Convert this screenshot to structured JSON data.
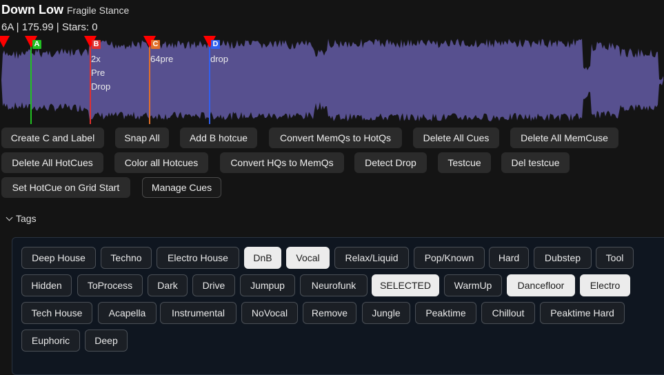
{
  "track": {
    "title": "Down Low",
    "artist": "Fragile Stance",
    "meta": "6A | 175.99 | Stars: 0"
  },
  "colors": {
    "waveform": "#57508f",
    "cue_a": "#22c022",
    "cue_b": "#e03030",
    "cue_c": "#e2702a",
    "cue_d": "#3060f0",
    "marker": "#ff0000"
  },
  "cues": [
    {
      "letter": "",
      "label": "",
      "color": "#ff0000"
    },
    {
      "letter": "A",
      "label": "",
      "color": "#22c022"
    },
    {
      "letter": "B",
      "label": "2x\nPre\nDrop",
      "color": "#e03030"
    },
    {
      "letter": "C",
      "label": "64pre",
      "color": "#e2702a"
    },
    {
      "letter": "D",
      "label": "drop",
      "color": "#3060f0"
    }
  ],
  "actions": [
    "Create C and Label",
    "Snap All",
    "Add B hotcue",
    "Convert MemQs to HotQs",
    "Delete All Cues",
    "Delete All MemCuse",
    "Delete All HotCues",
    "Color all Hotcues",
    "Convert HQs to MemQs",
    "Detect Drop",
    "Testcue",
    "Del testcue",
    "Set HotCue on Grid Start",
    "Manage Cues"
  ],
  "tags_section": {
    "label": "Tags"
  },
  "tags": [
    {
      "label": "Deep House",
      "selected": false
    },
    {
      "label": "Techno",
      "selected": false
    },
    {
      "label": "Electro House",
      "selected": false
    },
    {
      "label": "DnB",
      "selected": true
    },
    {
      "label": "Vocal",
      "selected": true
    },
    {
      "label": "Relax/Liquid",
      "selected": false
    },
    {
      "label": "Pop/Known",
      "selected": false
    },
    {
      "label": "Hard",
      "selected": false
    },
    {
      "label": "Dubstep",
      "selected": false
    },
    {
      "label": "Tool",
      "selected": false
    },
    {
      "label": "Hidden",
      "selected": false
    },
    {
      "label": "ToProcess",
      "selected": false
    },
    {
      "label": "Dark",
      "selected": false
    },
    {
      "label": "Drive",
      "selected": false
    },
    {
      "label": "Jumpup",
      "selected": false
    },
    {
      "label": "Neurofunk",
      "selected": false
    },
    {
      "label": "SELECTED",
      "selected": true
    },
    {
      "label": "WarmUp",
      "selected": false
    },
    {
      "label": "Dancefloor",
      "selected": true
    },
    {
      "label": "Electro",
      "selected": true
    },
    {
      "label": "Tech House",
      "selected": false
    },
    {
      "label": "Acapella",
      "selected": false
    },
    {
      "label": "Instrumental",
      "selected": false
    },
    {
      "label": "NoVocal",
      "selected": false
    },
    {
      "label": "Remove",
      "selected": false
    },
    {
      "label": "Jungle",
      "selected": false
    },
    {
      "label": "Peaktime",
      "selected": false
    },
    {
      "label": "Chillout",
      "selected": false
    },
    {
      "label": "Peaktime Hard",
      "selected": false
    },
    {
      "label": "Euphoric",
      "selected": false
    },
    {
      "label": "Deep",
      "selected": false
    }
  ]
}
